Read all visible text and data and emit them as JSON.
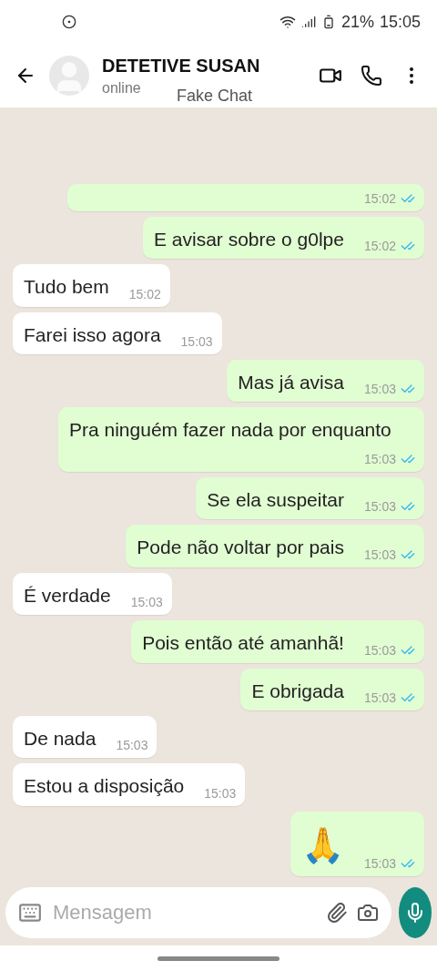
{
  "status_bar": {
    "battery": "21%",
    "time": "15:05"
  },
  "header": {
    "title": "DETETIVE SUSAN",
    "status": "online",
    "overlay_label": "Fake Chat"
  },
  "messages": [
    {
      "out": true,
      "time": "15:02",
      "read": true
    },
    {
      "out": true,
      "text": "E avisar sobre o g0lpe",
      "time": "15:02",
      "read": true
    },
    {
      "out": false,
      "text": "Tudo bem",
      "time": "15:02"
    },
    {
      "out": false,
      "text": "Farei isso agora",
      "time": "15:03"
    },
    {
      "out": true,
      "text": "Mas já avisa",
      "time": "15:03",
      "read": true
    },
    {
      "out": true,
      "text": "Pra ninguém fazer nada por enquanto",
      "time": "15:03",
      "read": true
    },
    {
      "out": true,
      "text": "Se ela suspeitar",
      "time": "15:03",
      "read": true
    },
    {
      "out": true,
      "text": "Pode não voltar por pais",
      "time": "15:03",
      "read": true
    },
    {
      "out": false,
      "text": "É verdade",
      "time": "15:03"
    },
    {
      "out": true,
      "text": "Pois então até amanhã!",
      "time": "15:03",
      "read": true
    },
    {
      "out": true,
      "text": "E obrigada",
      "time": "15:03",
      "read": true
    },
    {
      "out": false,
      "text": "De nada",
      "time": "15:03"
    },
    {
      "out": false,
      "text": "Estou a disposição",
      "time": "15:03"
    },
    {
      "out": true,
      "text": "🙏",
      "time": "15:03",
      "read": true,
      "kind": "emoji"
    }
  ],
  "composer": {
    "placeholder": "Mensagem"
  }
}
